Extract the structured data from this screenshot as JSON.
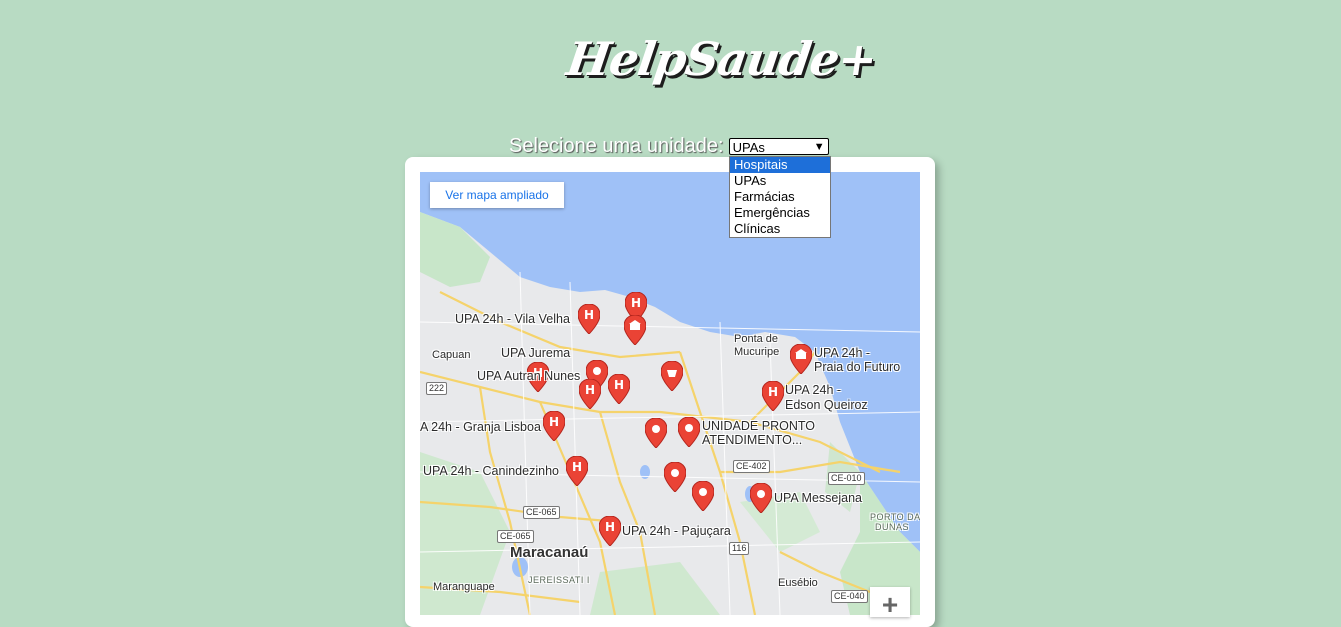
{
  "app": {
    "logo_text": "HelpSaude+"
  },
  "selector": {
    "label": "Selecione uma unidade:",
    "selected_value": "UPAs",
    "options": [
      "Hospitais",
      "UPAs",
      "Farmácias",
      "Emergências",
      "Clínicas"
    ],
    "highlighted_option": "Hospitais"
  },
  "map": {
    "expand_link": "Ver mapa ampliado",
    "zoom_in": "+",
    "labels": {
      "vila_velha": "UPA 24h - Vila Velha",
      "capuan": "Capuan",
      "jurema": "UPA Jurema",
      "autran": "UPA Autran Nunes",
      "granja": "A 24h - Granja Lisboa",
      "canindezinho": "UPA 24h - Canindezinho",
      "pajucara": "UPA 24h - Pajuçara",
      "maracanau": "Maracanaú",
      "maranguape": "Maranguape",
      "jereissati": "JEREISSATI I",
      "eusebio": "Eusébio",
      "messejana": "UPA Messejana",
      "upa_unidade_1": "UNIDADE PRONTO",
      "upa_unidade_2": "ATENDIMENTO...",
      "edson_1": "UPA 24h -",
      "edson_2": "Edson Queiroz",
      "futuro_1": "UPA 24h -",
      "futuro_2": "Praia do Futuro",
      "ponta_1": "Ponta de",
      "ponta_2": "Mucuripe",
      "porto_1": "PORTO DAS",
      "porto_2": "DUNAS"
    },
    "road_shields": [
      "222",
      "CE-065",
      "CE-065",
      "116",
      "CE-402",
      "CE-010",
      "CE-040"
    ],
    "colors": {
      "water": "#9fc1f7",
      "land": "#e8e9eb",
      "green": "#c8e6c9",
      "road": "#f7d774",
      "pin": "#ea4335"
    }
  }
}
